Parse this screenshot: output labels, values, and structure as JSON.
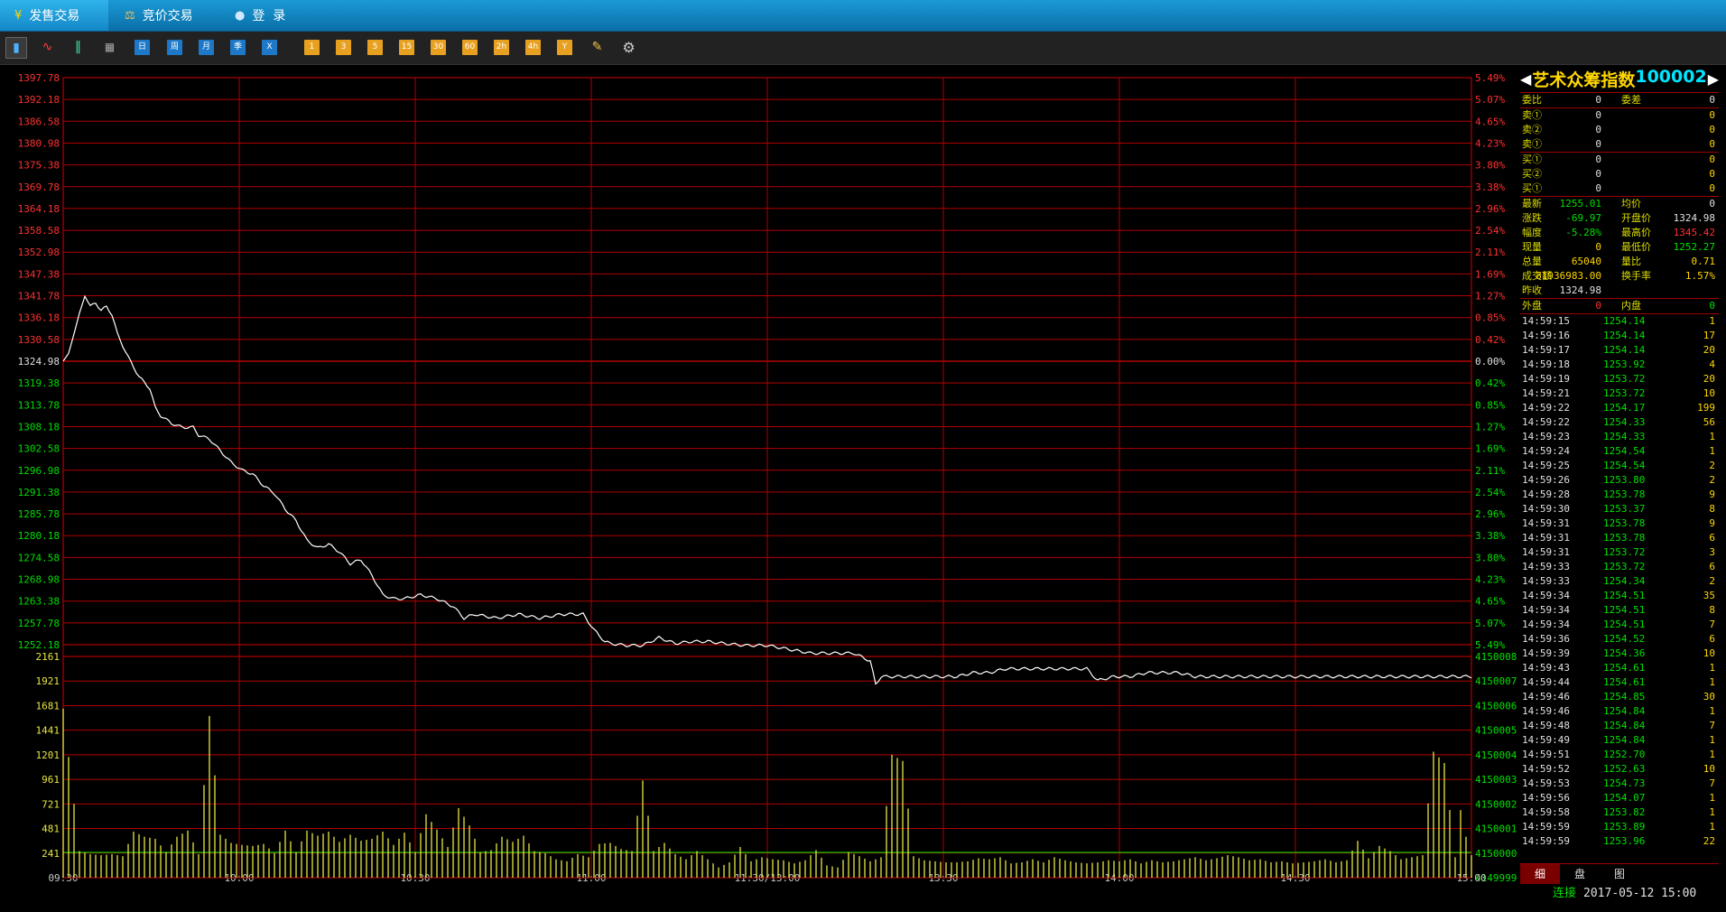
{
  "tabs": [
    {
      "label": "发售交易",
      "icon": "yuan-icon",
      "active": true
    },
    {
      "label": "竞价交易",
      "icon": "auction-icon",
      "active": false
    },
    {
      "label": "登  录",
      "icon": "user-icon",
      "active": false
    }
  ],
  "toolbar": {
    "chart_icons": [
      "bar-chart-icon",
      "line-chart-icon",
      "candlestick-icon",
      "calendar-icon"
    ],
    "periods": [
      "日",
      "周",
      "月",
      "季",
      "X"
    ],
    "minutes": [
      "1",
      "3",
      "5",
      "15",
      "30",
      "60",
      "2h",
      "4h",
      "Y"
    ],
    "tools": [
      "draw-icon",
      "gear-icon"
    ]
  },
  "colors": {
    "up": "#ff3030",
    "down": "#00e000",
    "grid": "#b00000",
    "price_line": "#ffffff",
    "volume": "#e8e840",
    "avg": "#00c800"
  },
  "chart_data": {
    "type": "line",
    "x_tick_labels": [
      "09:30",
      "10:00",
      "10:30",
      "11:00",
      "11:30/13:00",
      "13:30",
      "14:00",
      "14:30",
      "15:00"
    ],
    "price_axis_labels": [
      "1397.78",
      "1392.18",
      "1386.58",
      "1380.98",
      "1375.38",
      "1369.78",
      "1364.18",
      "1358.58",
      "1352.98",
      "1347.38",
      "1341.78",
      "1336.18",
      "1330.58",
      "1324.98",
      "1319.38",
      "1313.78",
      "1308.18",
      "1302.58",
      "1296.98",
      "1291.38",
      "1285.78",
      "1280.18",
      "1274.58",
      "1268.98",
      "1263.38",
      "1257.78",
      "1252.18"
    ],
    "pct_axis_labels": [
      "5.49%",
      "5.07%",
      "4.65%",
      "4.23%",
      "3.80%",
      "3.38%",
      "2.96%",
      "2.54%",
      "2.11%",
      "1.69%",
      "1.27%",
      "0.85%",
      "0.42%",
      "0.00%",
      "0.42%",
      "0.85%",
      "1.27%",
      "1.69%",
      "2.11%",
      "2.54%",
      "2.96%",
      "3.38%",
      "3.80%",
      "4.23%",
      "4.65%",
      "5.07%",
      "5.49%"
    ],
    "ylim": [
      1252.18,
      1397.78
    ],
    "prev_close": 1324.98,
    "price_keypoints": [
      [
        0,
        1324.98
      ],
      [
        1,
        1327
      ],
      [
        2,
        1332
      ],
      [
        4,
        1342
      ],
      [
        5,
        1339
      ],
      [
        6,
        1340
      ],
      [
        7,
        1338
      ],
      [
        8,
        1339
      ],
      [
        9,
        1337
      ],
      [
        10,
        1332
      ],
      [
        12,
        1326
      ],
      [
        14,
        1321
      ],
      [
        16,
        1318
      ],
      [
        17,
        1313
      ],
      [
        18,
        1311
      ],
      [
        20,
        1309
      ],
      [
        22,
        1308
      ],
      [
        24,
        1308
      ],
      [
        25,
        1306
      ],
      [
        27,
        1305
      ],
      [
        29,
        1302
      ],
      [
        31,
        1299
      ],
      [
        33,
        1297
      ],
      [
        35,
        1296
      ],
      [
        37,
        1293
      ],
      [
        39,
        1291
      ],
      [
        41,
        1287
      ],
      [
        43,
        1284
      ],
      [
        45,
        1279
      ],
      [
        47,
        1277
      ],
      [
        49,
        1278
      ],
      [
        51,
        1276
      ],
      [
        53,
        1273
      ],
      [
        55,
        1274
      ],
      [
        57,
        1270
      ],
      [
        59,
        1265
      ],
      [
        61,
        1264
      ],
      [
        63,
        1264
      ],
      [
        66,
        1265
      ],
      [
        69,
        1264
      ],
      [
        72,
        1262
      ],
      [
        74,
        1259
      ],
      [
        76,
        1260
      ],
      [
        80,
        1259
      ],
      [
        84,
        1260
      ],
      [
        88,
        1259
      ],
      [
        92,
        1260
      ],
      [
        96,
        1260
      ],
      [
        98,
        1256
      ],
      [
        100,
        1253
      ],
      [
        101,
        1252.5
      ],
      [
        104,
        1252
      ],
      [
        107,
        1252
      ],
      [
        110,
        1254
      ],
      [
        113,
        1252.5
      ],
      [
        116,
        1253
      ],
      [
        119,
        1253
      ],
      [
        122,
        1252.5
      ],
      [
        126,
        1252
      ],
      [
        130,
        1252
      ],
      [
        134,
        1251
      ],
      [
        138,
        1250
      ],
      [
        142,
        1250
      ],
      [
        146,
        1250
      ],
      [
        149,
        1248
      ],
      [
        150,
        1242
      ],
      [
        151,
        1244
      ],
      [
        153,
        1244
      ],
      [
        156,
        1244
      ],
      [
        159,
        1244
      ],
      [
        162,
        1244
      ],
      [
        165,
        1244
      ],
      [
        168,
        1245
      ],
      [
        171,
        1245
      ],
      [
        174,
        1246
      ],
      [
        177,
        1246
      ],
      [
        180,
        1246
      ],
      [
        183,
        1246
      ],
      [
        186,
        1246
      ],
      [
        189,
        1246
      ],
      [
        191,
        1243
      ],
      [
        194,
        1244
      ],
      [
        197,
        1244
      ],
      [
        200,
        1245
      ],
      [
        203,
        1245
      ],
      [
        206,
        1245
      ],
      [
        209,
        1244
      ],
      [
        212,
        1244
      ],
      [
        215,
        1244
      ],
      [
        218,
        1244
      ],
      [
        221,
        1244
      ],
      [
        224,
        1244
      ],
      [
        227,
        1244
      ],
      [
        230,
        1244
      ],
      [
        233,
        1244
      ],
      [
        236,
        1244
      ],
      [
        240,
        1244
      ],
      [
        243,
        1244
      ],
      [
        246,
        1244
      ],
      [
        249,
        1244
      ],
      [
        252,
        1244
      ],
      [
        255,
        1244
      ],
      [
        258,
        1244
      ],
      [
        260,
        1244
      ]
    ],
    "volume_axis_labels": [
      "2161",
      "1921",
      "1681",
      "1441",
      "1201",
      "961",
      "721",
      "481",
      "241"
    ],
    "oi_axis_labels": [
      "4150008",
      "4150007",
      "4150006",
      "4150005",
      "4150004",
      "4150003",
      "4150002",
      "4150001",
      "4150000",
      "4149999"
    ],
    "volume_keypoints": [
      [
        0,
        1650
      ],
      [
        1,
        1180
      ],
      [
        3,
        260
      ],
      [
        5,
        230
      ],
      [
        7,
        220
      ],
      [
        9,
        230
      ],
      [
        11,
        210
      ],
      [
        13,
        450
      ],
      [
        15,
        400
      ],
      [
        17,
        380
      ],
      [
        19,
        250
      ],
      [
        21,
        400
      ],
      [
        23,
        460
      ],
      [
        25,
        230
      ],
      [
        27,
        1580
      ],
      [
        29,
        420
      ],
      [
        31,
        340
      ],
      [
        33,
        320
      ],
      [
        35,
        310
      ],
      [
        37,
        330
      ],
      [
        39,
        240
      ],
      [
        41,
        460
      ],
      [
        43,
        250
      ],
      [
        45,
        460
      ],
      [
        47,
        410
      ],
      [
        49,
        450
      ],
      [
        51,
        350
      ],
      [
        53,
        420
      ],
      [
        55,
        360
      ],
      [
        57,
        380
      ],
      [
        59,
        450
      ],
      [
        61,
        320
      ],
      [
        63,
        440
      ],
      [
        65,
        250
      ],
      [
        67,
        620
      ],
      [
        69,
        470
      ],
      [
        71,
        300
      ],
      [
        73,
        680
      ],
      [
        75,
        510
      ],
      [
        77,
        250
      ],
      [
        79,
        270
      ],
      [
        81,
        400
      ],
      [
        83,
        350
      ],
      [
        85,
        410
      ],
      [
        87,
        260
      ],
      [
        89,
        240
      ],
      [
        91,
        180
      ],
      [
        93,
        160
      ],
      [
        95,
        230
      ],
      [
        97,
        200
      ],
      [
        99,
        330
      ],
      [
        101,
        340
      ],
      [
        103,
        280
      ],
      [
        105,
        260
      ],
      [
        107,
        950
      ],
      [
        109,
        260
      ],
      [
        111,
        340
      ],
      [
        113,
        230
      ],
      [
        115,
        180
      ],
      [
        117,
        260
      ],
      [
        119,
        180
      ],
      [
        121,
        100
      ],
      [
        123,
        150
      ],
      [
        125,
        300
      ],
      [
        127,
        160
      ],
      [
        129,
        200
      ],
      [
        131,
        180
      ],
      [
        133,
        170
      ],
      [
        135,
        140
      ],
      [
        137,
        170
      ],
      [
        139,
        270
      ],
      [
        141,
        120
      ],
      [
        143,
        100
      ],
      [
        145,
        250
      ],
      [
        147,
        210
      ],
      [
        149,
        160
      ],
      [
        151,
        200
      ],
      [
        153,
        1200
      ],
      [
        155,
        1140
      ],
      [
        157,
        210
      ],
      [
        159,
        170
      ],
      [
        161,
        160
      ],
      [
        163,
        150
      ],
      [
        165,
        150
      ],
      [
        167,
        160
      ],
      [
        169,
        190
      ],
      [
        171,
        180
      ],
      [
        173,
        200
      ],
      [
        175,
        140
      ],
      [
        177,
        150
      ],
      [
        179,
        180
      ],
      [
        181,
        150
      ],
      [
        183,
        200
      ],
      [
        185,
        170
      ],
      [
        187,
        150
      ],
      [
        189,
        140
      ],
      [
        191,
        150
      ],
      [
        193,
        170
      ],
      [
        195,
        160
      ],
      [
        197,
        180
      ],
      [
        199,
        140
      ],
      [
        201,
        170
      ],
      [
        203,
        150
      ],
      [
        205,
        160
      ],
      [
        207,
        180
      ],
      [
        209,
        200
      ],
      [
        211,
        170
      ],
      [
        213,
        190
      ],
      [
        215,
        220
      ],
      [
        217,
        200
      ],
      [
        219,
        170
      ],
      [
        221,
        180
      ],
      [
        223,
        150
      ],
      [
        225,
        160
      ],
      [
        227,
        140
      ],
      [
        229,
        150
      ],
      [
        231,
        160
      ],
      [
        233,
        180
      ],
      [
        235,
        150
      ],
      [
        237,
        170
      ],
      [
        239,
        360
      ],
      [
        241,
        190
      ],
      [
        243,
        310
      ],
      [
        245,
        260
      ],
      [
        247,
        180
      ],
      [
        249,
        200
      ],
      [
        251,
        220
      ],
      [
        253,
        1230
      ],
      [
        255,
        1120
      ],
      [
        257,
        200
      ],
      [
        258,
        660
      ],
      [
        259,
        400
      ],
      [
        260,
        220
      ]
    ]
  },
  "panel": {
    "title_name": "艺术众筹指数",
    "title_code": "100002",
    "order_ratio": {
      "label": "委比",
      "value": "0",
      "label2": "委差",
      "value2": "0"
    },
    "sells": [
      {
        "label": "卖①",
        "price": "0",
        "vol": "0"
      },
      {
        "label": "卖②",
        "price": "0",
        "vol": "0"
      },
      {
        "label": "卖①",
        "price": "0",
        "vol": "0"
      }
    ],
    "buys": [
      {
        "label": "买①",
        "price": "0",
        "vol": "0"
      },
      {
        "label": "买②",
        "price": "0",
        "vol": "0"
      },
      {
        "label": "买①",
        "price": "0",
        "vol": "0"
      }
    ],
    "quote": [
      {
        "l1": "最新",
        "v1": "1255.01",
        "c1": "grn",
        "l2": "均价",
        "v2": "0",
        "c2": "wht"
      },
      {
        "l1": "涨跌",
        "v1": "-69.97",
        "c1": "grn",
        "l2": "开盘价",
        "v2": "1324.98",
        "c2": "wht"
      },
      {
        "l1": "幅度",
        "v1": "-5.28%",
        "c1": "grn",
        "l2": "最高价",
        "v2": "1345.42",
        "c2": "red"
      },
      {
        "l1": "现量",
        "v1": "0",
        "c1": "yel",
        "l2": "最低价",
        "v2": "1252.27",
        "c2": "grn"
      },
      {
        "l1": "总量",
        "v1": "65040",
        "c1": "yel",
        "l2": "量比",
        "v2": "0.71",
        "c2": "yel"
      },
      {
        "l1": "成交额",
        "v1": "81936983.00",
        "c1": "yel",
        "l2": "换手率",
        "v2": "1.57%",
        "c2": "yel"
      },
      {
        "l1": "昨收",
        "v1": "1324.98",
        "c1": "wht",
        "l2": "",
        "v2": "",
        "c2": "wht"
      }
    ],
    "outer_inner": {
      "l1": "外盘",
      "v1": "0",
      "l2": "内盘",
      "v2": "0"
    },
    "ticks": [
      [
        "14:59:15",
        "1254.14",
        "1"
      ],
      [
        "14:59:16",
        "1254.14",
        "17"
      ],
      [
        "14:59:17",
        "1254.14",
        "20"
      ],
      [
        "14:59:18",
        "1253.92",
        "4"
      ],
      [
        "14:59:19",
        "1253.72",
        "20"
      ],
      [
        "14:59:21",
        "1253.72",
        "10"
      ],
      [
        "14:59:22",
        "1254.17",
        "199"
      ],
      [
        "14:59:22",
        "1254.33",
        "56"
      ],
      [
        "14:59:23",
        "1254.33",
        "1"
      ],
      [
        "14:59:24",
        "1254.54",
        "1"
      ],
      [
        "14:59:25",
        "1254.54",
        "2"
      ],
      [
        "14:59:26",
        "1253.80",
        "2"
      ],
      [
        "14:59:28",
        "1253.78",
        "9"
      ],
      [
        "14:59:30",
        "1253.37",
        "8"
      ],
      [
        "14:59:31",
        "1253.78",
        "9"
      ],
      [
        "14:59:31",
        "1253.78",
        "6"
      ],
      [
        "14:59:31",
        "1253.72",
        "3"
      ],
      [
        "14:59:33",
        "1253.72",
        "6"
      ],
      [
        "14:59:33",
        "1254.34",
        "2"
      ],
      [
        "14:59:34",
        "1254.51",
        "35"
      ],
      [
        "14:59:34",
        "1254.51",
        "8"
      ],
      [
        "14:59:34",
        "1254.51",
        "7"
      ],
      [
        "14:59:36",
        "1254.52",
        "6"
      ],
      [
        "14:59:39",
        "1254.36",
        "10"
      ],
      [
        "14:59:43",
        "1254.61",
        "1"
      ],
      [
        "14:59:44",
        "1254.61",
        "1"
      ],
      [
        "14:59:46",
        "1254.85",
        "30"
      ],
      [
        "14:59:46",
        "1254.84",
        "1"
      ],
      [
        "14:59:48",
        "1254.84",
        "7"
      ],
      [
        "14:59:49",
        "1254.84",
        "1"
      ],
      [
        "14:59:51",
        "1252.70",
        "1"
      ],
      [
        "14:59:52",
        "1252.63",
        "10"
      ],
      [
        "14:59:53",
        "1254.73",
        "7"
      ],
      [
        "14:59:56",
        "1254.07",
        "1"
      ],
      [
        "14:59:58",
        "1253.82",
        "1"
      ],
      [
        "14:59:59",
        "1253.89",
        "1"
      ],
      [
        "14:59:59",
        "1253.96",
        "22"
      ]
    ],
    "tabs": [
      "细",
      "盘",
      "图"
    ]
  },
  "status": {
    "conn": "连接",
    "datetime": "2017-05-12 15:00"
  }
}
